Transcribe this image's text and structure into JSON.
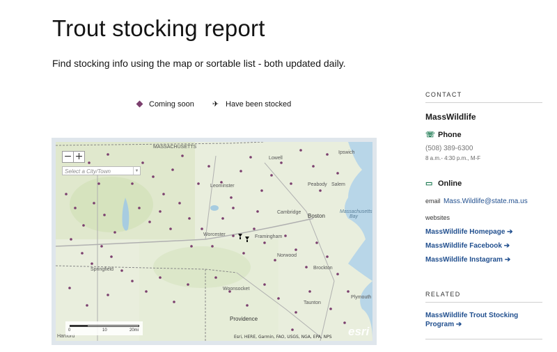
{
  "page": {
    "title": "Trout stocking report",
    "subtitle": "Find stocking info using the map or sortable list - both updated daily."
  },
  "legend": {
    "coming_soon": "Coming soon",
    "stocked": "Have been stocked",
    "coming_soon_color": "#7b3f6e"
  },
  "map": {
    "zoom_out": "−",
    "zoom_in": "+",
    "city_placeholder": "Select a City/Town",
    "attribution": "Esri, HERE, Garmin, FAO, USGS, NGA, EPA, NPS",
    "logo": "esri",
    "scale_labels": [
      "0",
      "10",
      "20mi"
    ],
    "place_labels": [
      "MASSACHUSETTS",
      "Lowell",
      "Ipswich",
      "Leominster",
      "Peabody",
      "Salem",
      "Cambridge",
      "Boston",
      "Massachusetts Bay",
      "Worcester",
      "Framingham",
      "Springfield",
      "Norwood",
      "Brockton",
      "Woonsocket",
      "Providence",
      "Taunton",
      "Plymouth",
      "Hartford"
    ]
  },
  "sidebar": {
    "contact_heading": "CONTACT",
    "org": "MassWildlife",
    "phone_label": "Phone",
    "phone_number": "(508) 389-6300",
    "hours": "8 a.m.- 4:30 p.m., M-F",
    "online_label": "Online",
    "email_prefix": "email",
    "email": "Mass.Wildlife@state.ma.us",
    "websites_label": "websites",
    "links": [
      "MassWildlife Homepage ➔",
      "MassWildlife Facebook ➔",
      "MassWildlife Instagram ➔"
    ],
    "related_heading": "RELATED",
    "related_link": "MassWildlife Trout Stocking Program ➔"
  }
}
